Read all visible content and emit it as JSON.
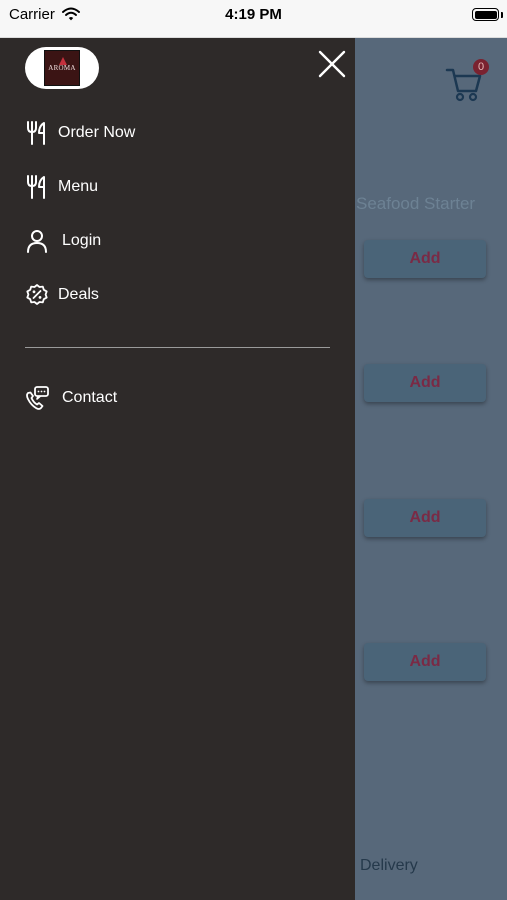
{
  "status_bar": {
    "carrier": "Carrier",
    "time": "4:19 PM"
  },
  "background": {
    "cart_count": "0",
    "category": "Seafood Starter",
    "add_buttons": [
      "Add",
      "Add",
      "Add",
      "Add"
    ],
    "delivery": "Delivery"
  },
  "drawer": {
    "logo_text": "AROMA",
    "items": [
      {
        "label": "Order Now",
        "icon": "fork-knife-icon"
      },
      {
        "label": "Menu",
        "icon": "fork-knife-icon"
      },
      {
        "label": "Login",
        "icon": "user-icon"
      },
      {
        "label": "Deals",
        "icon": "discount-badge-icon"
      }
    ],
    "contact": {
      "label": "Contact",
      "icon": "phone-chat-icon"
    }
  },
  "colors": {
    "drawer_bg": "#2e2a29",
    "overlay": "#4c6a82",
    "accent": "#7a2230"
  }
}
